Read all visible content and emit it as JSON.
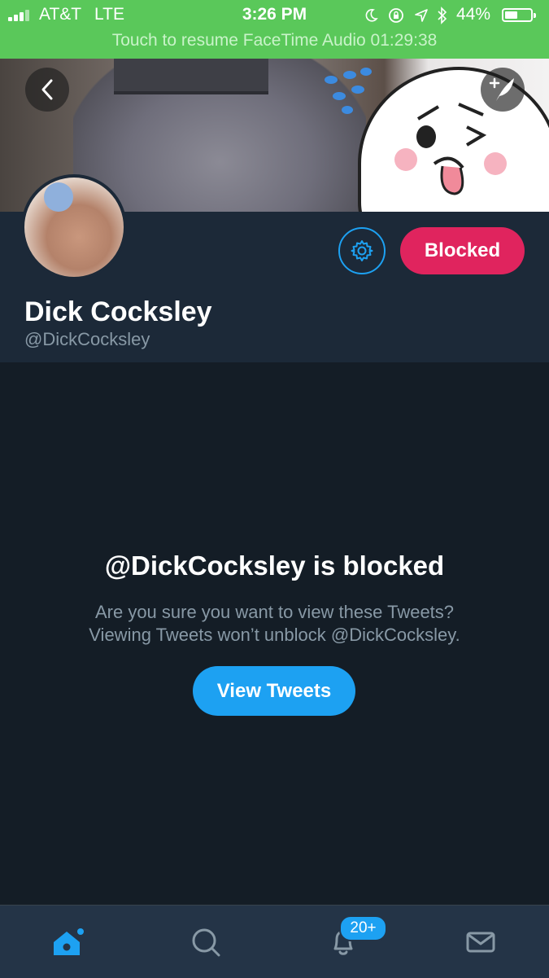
{
  "status_bar": {
    "carrier": "AT&T",
    "network": "LTE",
    "time": "3:26 PM",
    "battery": "44%",
    "battery_level": 0.44,
    "banner_text": "Touch to resume FaceTime Audio 01:29:38",
    "banner_color": "#5ac85a"
  },
  "profile": {
    "display_name": "Dick Cocksley",
    "handle": "@DickCocksley",
    "blocked_button": "Blocked"
  },
  "blocked_notice": {
    "title": "@DickCocksley is blocked",
    "line1": "Are you sure you want to view these Tweets?",
    "line2": "Viewing Tweets won’t unblock @DickCocksley.",
    "button": "View Tweets"
  },
  "tab_bar": {
    "tabs": [
      "home-icon",
      "search-icon",
      "bell-icon",
      "mail-icon"
    ],
    "notification_badge": "20+"
  },
  "colors": {
    "background": "#141d26",
    "profile_background": "#1c2938",
    "accent": "#1da1f2",
    "blocked": "#e0245e",
    "secondary_text": "#8899a6"
  }
}
